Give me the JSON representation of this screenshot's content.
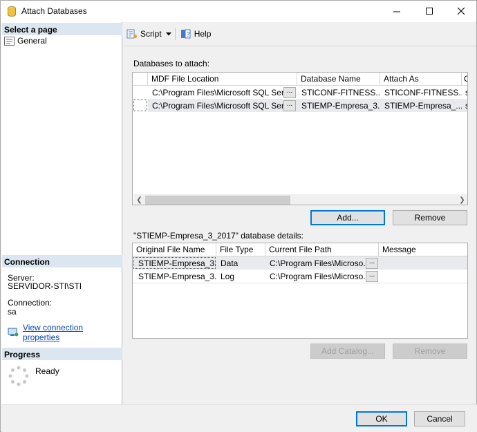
{
  "window": {
    "title": "Attach Databases"
  },
  "left": {
    "select_page": "Select a page",
    "pages": [
      "General"
    ],
    "connection_head": "Connection",
    "server_label": "Server:",
    "server_value": "SERVIDOR-STI\\STI",
    "connection_label": "Connection:",
    "connection_value": "sa",
    "view_link": "View connection properties",
    "progress_head": "Progress",
    "progress_status": "Ready"
  },
  "toolbar": {
    "script": "Script",
    "help": "Help"
  },
  "attach": {
    "label": "Databases to attach:",
    "columns": [
      "MDF File Location",
      "Database Name",
      "Attach As",
      "O"
    ],
    "rows": [
      {
        "mdf": "C:\\Program Files\\Microsoft SQL Ser...",
        "dbname": "STICONF-FITNESS...",
        "attach_as": "STICONF-FITNESS...",
        "owner": "s"
      },
      {
        "mdf": "C:\\Program Files\\Microsoft SQL Ser...",
        "dbname": "STIEMP-Empresa_3...",
        "attach_as": "STIEMP-Empresa_...",
        "owner": "s"
      }
    ],
    "ellipsis": "...",
    "add": "Add...",
    "remove": "Remove"
  },
  "details": {
    "label": "\"STIEMP-Empresa_3_2017\" database details:",
    "columns": [
      "Original File Name",
      "File Type",
      "Current File Path",
      "Message"
    ],
    "rows": [
      {
        "name": "STIEMP-Empresa_3...",
        "type": "Data",
        "path": "C:\\Program Files\\Microso...",
        "message": ""
      },
      {
        "name": "STIEMP-Empresa_3...",
        "type": "Log",
        "path": "C:\\Program Files\\Microso...",
        "message": ""
      }
    ],
    "ellipsis": "...",
    "add_catalog": "Add Catalog...",
    "remove": "Remove"
  },
  "footer": {
    "ok": "OK",
    "cancel": "Cancel"
  }
}
